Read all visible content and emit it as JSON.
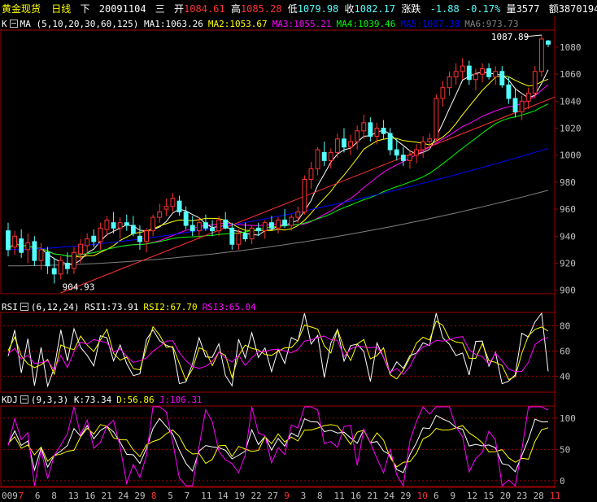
{
  "header": {
    "name": "黄金现货",
    "period": "日线",
    "direction": "下",
    "date": "20091104",
    "weekday": "三",
    "open_label": "开",
    "open": "1084.61",
    "high_label": "高",
    "high": "1085.28",
    "low_label": "低",
    "low": "1079.98",
    "close_label": "收",
    "close": "1082.17",
    "change_label": "涨跌",
    "change": "-1.88",
    "change_pct": "-0.17%",
    "volume_label": "量",
    "volume": "3577",
    "amount_label": "额",
    "amount": "3870194"
  },
  "panels": {
    "main": {
      "code": "K",
      "indicator": "MA",
      "params": "(5,10,20,30,60,125)"
    },
    "rsi": {
      "name": "RSI",
      "params": "(6,12,24)"
    },
    "kdj": {
      "name": "KDJ",
      "params": "(9,3,3)"
    }
  },
  "colors": {
    "up": "#ff3232",
    "down": "#54ffff",
    "grid": "#a00000",
    "axis_text": "#c0c0c0",
    "ma1": "#ffffff",
    "ma2": "#ffff00",
    "ma3": "#ff00ff",
    "ma4": "#00ff00",
    "ma5": "#0000ff",
    "ma6": "#808080",
    "trendline": "#ff3232"
  },
  "chart_data": [
    {
      "type": "candlestick",
      "title": "K MA(5,10,20,30,60,125)",
      "series": [
        {
          "name": "MA1",
          "label": "MA1:1063.26",
          "color": "#ffffff"
        },
        {
          "name": "MA2",
          "label": "MA2:1053.67",
          "color": "#ffff00"
        },
        {
          "name": "MA3",
          "label": "MA3:1055.21",
          "color": "#ff00ff"
        },
        {
          "name": "MA4",
          "label": "MA4:1039.46",
          "color": "#00ff00"
        },
        {
          "name": "MA5",
          "label": "MA5:1007.38",
          "color": "#0000ff"
        },
        {
          "name": "MA6",
          "label": "MA6:973.73",
          "color": "#808080"
        }
      ],
      "candles": [
        {
          "o": 944,
          "h": 950,
          "l": 925,
          "c": 930
        },
        {
          "o": 932,
          "h": 944,
          "l": 926,
          "c": 940
        },
        {
          "o": 938,
          "h": 945,
          "l": 924,
          "c": 928
        },
        {
          "o": 930,
          "h": 942,
          "l": 920,
          "c": 935
        },
        {
          "o": 936,
          "h": 940,
          "l": 918,
          "c": 922
        },
        {
          "o": 922,
          "h": 935,
          "l": 915,
          "c": 930
        },
        {
          "o": 928,
          "h": 932,
          "l": 912,
          "c": 918
        },
        {
          "o": 916,
          "h": 924,
          "l": 905,
          "c": 912
        },
        {
          "o": 912,
          "h": 925,
          "l": 908,
          "c": 922
        },
        {
          "o": 920,
          "h": 928,
          "l": 912,
          "c": 916
        },
        {
          "o": 916,
          "h": 932,
          "l": 912,
          "c": 928
        },
        {
          "o": 927,
          "h": 938,
          "l": 920,
          "c": 934
        },
        {
          "o": 933,
          "h": 942,
          "l": 925,
          "c": 938
        },
        {
          "o": 940,
          "h": 945,
          "l": 932,
          "c": 936
        },
        {
          "o": 936,
          "h": 950,
          "l": 930,
          "c": 946
        },
        {
          "o": 945,
          "h": 955,
          "l": 940,
          "c": 952
        },
        {
          "o": 950,
          "h": 958,
          "l": 942,
          "c": 946
        },
        {
          "o": 946,
          "h": 954,
          "l": 938,
          "c": 950
        },
        {
          "o": 950,
          "h": 956,
          "l": 944,
          "c": 948
        },
        {
          "o": 948,
          "h": 955,
          "l": 940,
          "c": 942
        },
        {
          "o": 940,
          "h": 948,
          "l": 930,
          "c": 936
        },
        {
          "o": 936,
          "h": 946,
          "l": 928,
          "c": 944
        },
        {
          "o": 944,
          "h": 956,
          "l": 940,
          "c": 954
        },
        {
          "o": 954,
          "h": 964,
          "l": 950,
          "c": 958
        },
        {
          "o": 960,
          "h": 968,
          "l": 955,
          "c": 962
        },
        {
          "o": 962,
          "h": 972,
          "l": 958,
          "c": 968
        },
        {
          "o": 966,
          "h": 970,
          "l": 955,
          "c": 958
        },
        {
          "o": 958,
          "h": 962,
          "l": 945,
          "c": 948
        },
        {
          "o": 948,
          "h": 955,
          "l": 940,
          "c": 944
        },
        {
          "o": 944,
          "h": 954,
          "l": 938,
          "c": 950
        },
        {
          "o": 950,
          "h": 956,
          "l": 944,
          "c": 946
        },
        {
          "o": 946,
          "h": 952,
          "l": 940,
          "c": 944
        },
        {
          "o": 944,
          "h": 955,
          "l": 940,
          "c": 952
        },
        {
          "o": 952,
          "h": 958,
          "l": 945,
          "c": 946
        },
        {
          "o": 946,
          "h": 950,
          "l": 930,
          "c": 934
        },
        {
          "o": 934,
          "h": 945,
          "l": 930,
          "c": 942
        },
        {
          "o": 942,
          "h": 950,
          "l": 936,
          "c": 938
        },
        {
          "o": 938,
          "h": 948,
          "l": 934,
          "c": 946
        },
        {
          "o": 946,
          "h": 950,
          "l": 940,
          "c": 944
        },
        {
          "o": 944,
          "h": 952,
          "l": 938,
          "c": 950
        },
        {
          "o": 950,
          "h": 955,
          "l": 944,
          "c": 946
        },
        {
          "o": 946,
          "h": 954,
          "l": 942,
          "c": 952
        },
        {
          "o": 952,
          "h": 960,
          "l": 946,
          "c": 948
        },
        {
          "o": 948,
          "h": 956,
          "l": 944,
          "c": 954
        },
        {
          "o": 954,
          "h": 962,
          "l": 950,
          "c": 958
        },
        {
          "o": 958,
          "h": 985,
          "l": 956,
          "c": 982
        },
        {
          "o": 982,
          "h": 995,
          "l": 975,
          "c": 990
        },
        {
          "o": 990,
          "h": 1006,
          "l": 985,
          "c": 1004
        },
        {
          "o": 1002,
          "h": 1010,
          "l": 992,
          "c": 996
        },
        {
          "o": 996,
          "h": 1005,
          "l": 990,
          "c": 1002
        },
        {
          "o": 1002,
          "h": 1016,
          "l": 998,
          "c": 1012
        },
        {
          "o": 1012,
          "h": 1020,
          "l": 1002,
          "c": 1006
        },
        {
          "o": 1006,
          "h": 1015,
          "l": 1000,
          "c": 1010
        },
        {
          "o": 1010,
          "h": 1022,
          "l": 1004,
          "c": 1018
        },
        {
          "o": 1018,
          "h": 1030,
          "l": 1012,
          "c": 1024
        },
        {
          "o": 1024,
          "h": 1028,
          "l": 1010,
          "c": 1014
        },
        {
          "o": 1014,
          "h": 1024,
          "l": 1008,
          "c": 1020
        },
        {
          "o": 1020,
          "h": 1026,
          "l": 1012,
          "c": 1016
        },
        {
          "o": 1016,
          "h": 1020,
          "l": 1000,
          "c": 1004
        },
        {
          "o": 1004,
          "h": 1012,
          "l": 996,
          "c": 1000
        },
        {
          "o": 1000,
          "h": 1006,
          "l": 992,
          "c": 996
        },
        {
          "o": 996,
          "h": 1004,
          "l": 990,
          "c": 1000
        },
        {
          "o": 1000,
          "h": 1008,
          "l": 994,
          "c": 1004
        },
        {
          "o": 1004,
          "h": 1014,
          "l": 998,
          "c": 1010
        },
        {
          "o": 1010,
          "h": 1016,
          "l": 1004,
          "c": 1012
        },
        {
          "o": 1012,
          "h": 1045,
          "l": 1010,
          "c": 1042
        },
        {
          "o": 1042,
          "h": 1055,
          "l": 1036,
          "c": 1050
        },
        {
          "o": 1050,
          "h": 1062,
          "l": 1044,
          "c": 1058
        },
        {
          "o": 1058,
          "h": 1068,
          "l": 1052,
          "c": 1062
        },
        {
          "o": 1062,
          "h": 1072,
          "l": 1056,
          "c": 1066
        },
        {
          "o": 1066,
          "h": 1070,
          "l": 1052,
          "c": 1056
        },
        {
          "o": 1056,
          "h": 1064,
          "l": 1048,
          "c": 1060
        },
        {
          "o": 1060,
          "h": 1068,
          "l": 1054,
          "c": 1064
        },
        {
          "o": 1064,
          "h": 1068,
          "l": 1056,
          "c": 1058
        },
        {
          "o": 1058,
          "h": 1066,
          "l": 1052,
          "c": 1062
        },
        {
          "o": 1062,
          "h": 1066,
          "l": 1050,
          "c": 1052
        },
        {
          "o": 1052,
          "h": 1058,
          "l": 1038,
          "c": 1042
        },
        {
          "o": 1042,
          "h": 1050,
          "l": 1028,
          "c": 1032
        },
        {
          "o": 1032,
          "h": 1044,
          "l": 1026,
          "c": 1040
        },
        {
          "o": 1040,
          "h": 1050,
          "l": 1034,
          "c": 1046
        },
        {
          "o": 1046,
          "h": 1066,
          "l": 1042,
          "c": 1062
        },
        {
          "o": 1062,
          "h": 1089,
          "l": 1058,
          "c": 1086
        },
        {
          "o": 1084.61,
          "h": 1085.28,
          "l": 1079.98,
          "c": 1082.17
        }
      ],
      "annotations": [
        "1087.89",
        "904.93"
      ],
      "y_ticks": [
        "1080",
        "1060",
        "1040",
        "1020",
        "1000",
        "980",
        "960",
        "940",
        "920",
        "900"
      ],
      "ylim": [
        898,
        1092
      ]
    },
    {
      "type": "line",
      "title": "RSI(6,12,24)",
      "series": [
        {
          "name": "RSI1",
          "label": "RSI1:73.91",
          "color": "#ffffff"
        },
        {
          "name": "RSI2",
          "label": "RSI2:67.70",
          "color": "#ffff00"
        },
        {
          "name": "RSI3",
          "label": "RSI3:65.04",
          "color": "#ff00ff"
        }
      ],
      "y_ticks": [
        "80",
        "60",
        "40"
      ],
      "ylim": [
        28,
        90
      ]
    },
    {
      "type": "line",
      "title": "KDJ(9,3,3)",
      "series": [
        {
          "name": "K",
          "label": "K:73.34",
          "color": "#ffffff"
        },
        {
          "name": "D",
          "label": "D:56.86",
          "color": "#ffff00"
        },
        {
          "name": "J",
          "label": "J:106.31",
          "color": "#ff00ff"
        }
      ],
      "y_ticks": [
        "100",
        "50",
        "0"
      ],
      "ylim": [
        -8,
        118
      ]
    }
  ],
  "x_axis": {
    "labels": [
      {
        "t": "009",
        "red": false
      },
      {
        "t": "7",
        "red": true
      },
      {
        "t": "6",
        "red": false
      },
      {
        "t": "8",
        "red": false
      },
      {
        "t": "13",
        "red": false
      },
      {
        "t": "16",
        "red": false
      },
      {
        "t": "21",
        "red": false
      },
      {
        "t": "24",
        "red": false
      },
      {
        "t": "29",
        "red": false
      },
      {
        "t": "8",
        "red": true
      },
      {
        "t": "5",
        "red": false
      },
      {
        "t": "7",
        "red": false
      },
      {
        "t": "11",
        "red": false
      },
      {
        "t": "14",
        "red": false
      },
      {
        "t": "19",
        "red": false
      },
      {
        "t": "22",
        "red": false
      },
      {
        "t": "27",
        "red": false
      },
      {
        "t": "9",
        "red": true
      },
      {
        "t": "3",
        "red": false
      },
      {
        "t": "8",
        "red": false
      },
      {
        "t": "11",
        "red": false
      },
      {
        "t": "16",
        "red": false
      },
      {
        "t": "21",
        "red": false
      },
      {
        "t": "24",
        "red": false
      },
      {
        "t": "29",
        "red": false
      },
      {
        "t": "10",
        "red": true
      },
      {
        "t": "6",
        "red": false
      },
      {
        "t": "9",
        "red": false
      },
      {
        "t": "12",
        "red": false
      },
      {
        "t": "15",
        "red": false
      },
      {
        "t": "20",
        "red": false
      },
      {
        "t": "23",
        "red": false
      },
      {
        "t": "28",
        "red": false
      },
      {
        "t": "11",
        "red": true
      }
    ]
  }
}
